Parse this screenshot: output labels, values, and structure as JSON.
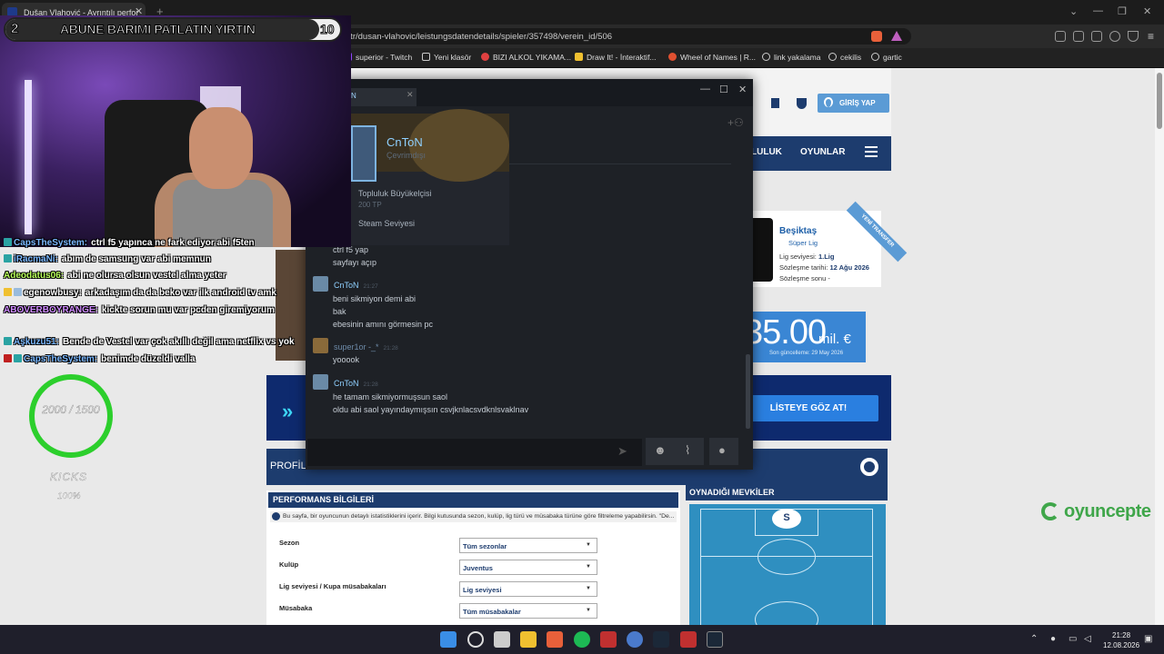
{
  "browser": {
    "tab_title": "Dušan Vlahović - Ayrıntılı perfor",
    "tab_close": "✕",
    "new_tab": "+",
    "url": "transfermarkt.com.tr/dusan-vlahovic/leistungsdatendetails/spieler/357498/verein_id/506",
    "window_controls": [
      "⌄",
      "—",
      "❐",
      "✕"
    ],
    "bookmarks": [
      {
        "label": "superior - Twitch",
        "color": "#9146ff"
      },
      {
        "label": "Yeni klasör",
        "color": "#cccccc"
      },
      {
        "label": "BIZI ALKOL YIKAMA...",
        "color": "#e04040"
      },
      {
        "label": "Draw It! - İnteraktif...",
        "color": "#f0c030"
      },
      {
        "label": "Wheel of Names | R...",
        "color": "#e05030"
      },
      {
        "label": "link yakalama",
        "color": "#cccccc"
      },
      {
        "label": "cekilis",
        "color": "#cccccc"
      },
      {
        "label": "gartic",
        "color": "#cccccc"
      }
    ]
  },
  "transfermarkt": {
    "login": "GİRİŞ YAP",
    "nav": [
      "LULUK",
      "OYUNLAR"
    ],
    "club": {
      "name": "Beşiktaş",
      "league": "Süper Lig",
      "level_label": "Lig seviyesi:",
      "level_value": "1.Lig",
      "contract_label": "Sözleşme tarihi:",
      "contract_value": "12 Ağu 2026",
      "end_label": "Sözleşme sonu -",
      "ribbon": "YENİ TRANSFER"
    },
    "market_value": {
      "value": "35.00",
      "unit": "mil. €",
      "updated": "Son güncelleme: 29 May 2026"
    },
    "banner_button": "LİSTEYE GÖZ AT!",
    "banner_arrow": "»",
    "profil": "PROFİL",
    "performance": {
      "heading": "PERFORMANS BİLGİLERİ",
      "info": "Bu sayfa, bir oyuncunun detaylı istatistiklerini içerir. Bilgi kutusunda sezon, kulüp, lig türü ve müsabaka türüne göre filtreleme yapabilirsin. \"De...",
      "filters": [
        {
          "label": "Sezon",
          "value": "Tüm sezonlar"
        },
        {
          "label": "Kulüp",
          "value": "Juventus"
        },
        {
          "label": "Lig seviyesi / Kupa müsabakaları",
          "value": "Lig seviyesi"
        },
        {
          "label": "Müsabaka",
          "value": "Tüm müsabakalar"
        }
      ]
    },
    "positions": {
      "heading": "OYNADIĞI MEVKİLER",
      "marker": "S"
    },
    "partner": "oyuncepte"
  },
  "steam": {
    "tab_label": "N",
    "tab_close": "✕",
    "window_controls": [
      "—",
      "☐",
      "✕"
    ],
    "popup": {
      "name": "CnToN",
      "status": "Çevrimdışı",
      "badge_name": "Topluluk Büyükelçisi",
      "badge_xp": "200 TP",
      "level_label": "Steam Seviyesi"
    },
    "messages": [
      {
        "author": "",
        "time": "",
        "lines": [
          "ctrl f5 yap",
          "sayfayı açıp"
        ]
      },
      {
        "author": "CnToN",
        "time": "21:27",
        "lines": [
          "beni sikmiyon demi abi",
          "bak",
          "ebesinin amını görmesin pc"
        ],
        "color": "#8fd0ff"
      },
      {
        "author": "super1or -_*",
        "time": "21:28",
        "lines": [
          "yooook"
        ],
        "color": "#6d8aa8"
      },
      {
        "author": "CnToN",
        "time": "21:28",
        "lines": [
          "he tamam sikmiyormuşsun saol",
          "oldu abi saol yayındaymışsın csvjknlacsvdknlsvaklnav"
        ],
        "color": "#8fd0ff"
      }
    ],
    "send_icon": "send-icon"
  },
  "overlay": {
    "goal": {
      "left": "2",
      "text": "ABUNE BARIMI PATLATIN YIRTIN",
      "right": "10"
    },
    "kicks": {
      "progress": "2000 / 1500",
      "label": "KICKS",
      "percent": "100%"
    },
    "chat": [
      {
        "name": "CapsTheSystem:",
        "text": "ctrl f5 yapınca ne fark ediyor abi f5ten",
        "color": "#7ab8ff"
      },
      {
        "name": "iRacmaNi:",
        "text": "abım de samsung var abi memnun",
        "color": "#7ab8ff"
      },
      {
        "name": "Adeodatus06:",
        "text": "abi ne olursa olsun vestel alma yeter",
        "color": "#b8ff5a"
      },
      {
        "name": "egenowbusy:",
        "text": "arkadaşım da da beko var ilk android tv amk",
        "color": "#ffffff"
      },
      {
        "name": "ABOVERBOYRANGE:",
        "text": "kickte sorun mu var pcden giremiyorum",
        "color": "#d08cff"
      },
      {
        "name": "Aşkuzu51:",
        "text": "Bende de Vestel var çok akıllı değil ama netflix vs yok",
        "color": "#7ab8ff"
      },
      {
        "name": "CapsTheSystem:",
        "text": "benimde düzeldi valla",
        "color": "#7ab8ff"
      }
    ]
  },
  "taskbar": {
    "time": "21:28",
    "date": "12.08.2026"
  }
}
